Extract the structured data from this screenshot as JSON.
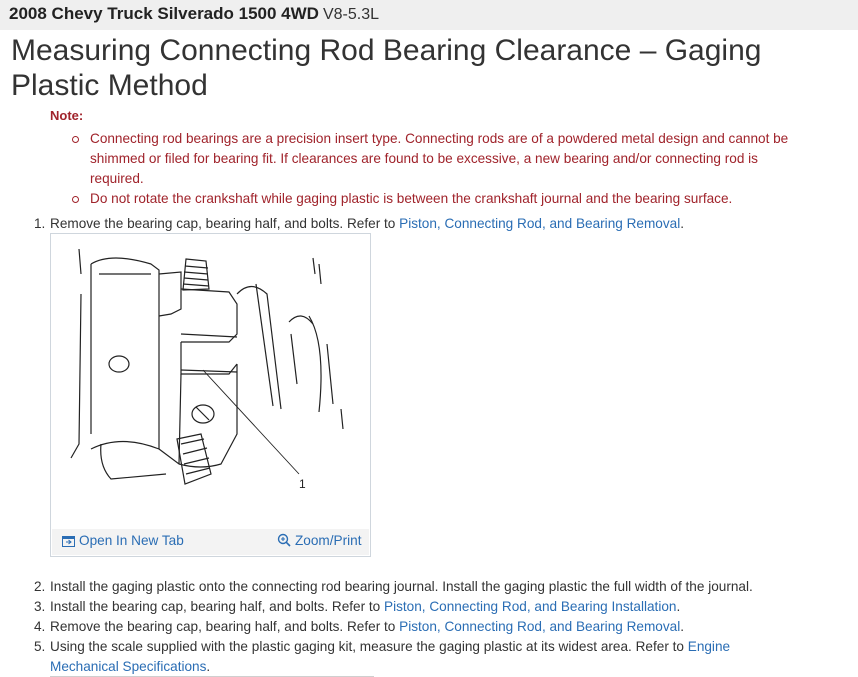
{
  "header": {
    "vehicle": "2008 Chevy Truck Silverado 1500 4WD",
    "engine": "V8-5.3L"
  },
  "title": "Measuring Connecting Rod Bearing Clearance – Gaging Plastic Method",
  "note": {
    "label": "Note:",
    "items": [
      "Connecting rod bearings are a precision insert type. Connecting rods are of a powdered metal design and cannot be shimmed or filed for bearing fit. If clearances are found to be excessive, a new bearing and/or connecting rod is required.",
      "Do not rotate the crankshaft while gaging plastic is between the crankshaft journal and the bearing surface."
    ]
  },
  "steps": [
    {
      "num": "1.",
      "text": "Remove the bearing cap, bearing half, and bolts. Refer to ",
      "link": "Piston, Connecting Rod, and Bearing Removal",
      "after": "."
    },
    {
      "num": "2.",
      "text": "Install the gaging plastic onto the connecting rod bearing journal. Install the gaging plastic the full width of the journal."
    },
    {
      "num": "3.",
      "text": "Install the bearing cap, bearing half, and bolts. Refer to ",
      "link": "Piston, Connecting Rod, and Bearing Installation",
      "after": "."
    },
    {
      "num": "4.",
      "text": "Remove the bearing cap, bearing half, and bolts. Refer to ",
      "link": "Piston, Connecting Rod, and Bearing Removal",
      "after": "."
    },
    {
      "num": "5.",
      "text": "Using the scale supplied with the plastic gaging kit, measure the gaging plastic at its widest area. Refer to ",
      "link": "Engine",
      "line2_link": "Mechanical Specifications",
      "after": "."
    }
  ],
  "figure": {
    "callout": "1",
    "open_new_tab": "Open In New Tab",
    "zoom_print": "Zoom/Print",
    "open_icon": "open-in-new-tab-icon",
    "zoom_icon": "zoom-icon"
  },
  "colors": {
    "note": "#a0232b",
    "link": "#2a6db4",
    "header_bg": "#efefef"
  }
}
